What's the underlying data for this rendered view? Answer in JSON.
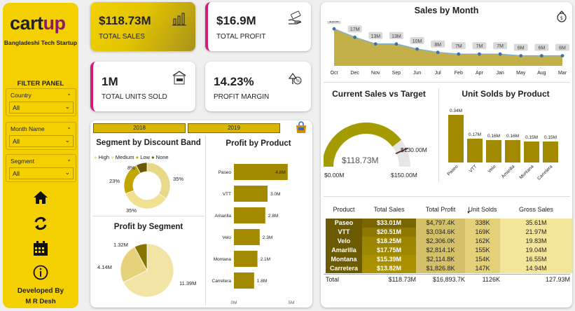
{
  "sidebar": {
    "logo_a": "cart",
    "logo_b": "up",
    "subtitle": "Bangladeshi Tech Startup",
    "filter_title": "FILTER PANEL",
    "filters": [
      {
        "label": "Country",
        "value": "All"
      },
      {
        "label": "Month Name",
        "value": "All"
      },
      {
        "label": "Segment",
        "value": "All"
      }
    ],
    "developed_by": "Developed By",
    "developer": "M R Desh"
  },
  "kpis": [
    {
      "value": "$118.73M",
      "label": "TOTAL SALES",
      "icon": "bar-chart-icon"
    },
    {
      "value": "$16.9M",
      "label": "TOTAL PROFIT",
      "icon": "money-hand-icon"
    },
    {
      "value": "1M",
      "label": "TOTAL UNITS SOLD",
      "icon": "shop-sold-icon"
    },
    {
      "value": "14.23%",
      "label": "PROFIT MARGIN",
      "icon": "margin-up-icon"
    }
  ],
  "year_buttons": [
    "2018",
    "2019"
  ],
  "segment_discount": {
    "title": "Segment by Discount Band",
    "legend": [
      "High",
      "Medium",
      "Low",
      "None"
    ],
    "colors": [
      "#e8d98a",
      "#f0e090",
      "#bfa700",
      "#6b5800"
    ],
    "slice_labels": [
      "35%",
      "35%",
      "23%",
      "8%"
    ]
  },
  "profit_segment": {
    "title": "Profit by Segment",
    "labels": [
      "11.39M",
      "4.14M",
      "1.32M"
    ]
  },
  "profit_product": {
    "title": "Profit by Product",
    "axis": [
      "0M",
      "5M"
    ]
  },
  "sales_month": {
    "title": "Sales by Month"
  },
  "target": {
    "title": "Current Sales vs Target",
    "value": "$118.73M",
    "target": "$130.00M",
    "min": "$0.00M",
    "max": "$150.00M"
  },
  "units_product": {
    "title": "Unit Solds by Product"
  },
  "table": {
    "headers": [
      "Product",
      "Total Sales",
      "Total Profit",
      "Unit Solds",
      "Gross Sales"
    ],
    "rows": [
      [
        "Paseo",
        "$33.01M",
        "$4,797.4K",
        "338K",
        "35.61M"
      ],
      [
        "VTT",
        "$20.51M",
        "$3,034.6K",
        "169K",
        "21.97M"
      ],
      [
        "Velo",
        "$18.25M",
        "$2,306.0K",
        "162K",
        "19.83M"
      ],
      [
        "Amarilla",
        "$17.75M",
        "$2,814.1K",
        "155K",
        "19.04M"
      ],
      [
        "Montana",
        "$15.39M",
        "$2,114.8K",
        "154K",
        "16.55M"
      ],
      [
        "Carretera",
        "$13.82M",
        "$1,826.8K",
        "147K",
        "14.94M"
      ]
    ],
    "total": [
      "Total",
      "$118.73M",
      "$16,893.7K",
      "1126K",
      "127.93M"
    ]
  },
  "chart_data": [
    {
      "type": "area",
      "title": "Sales by Month",
      "categories": [
        "Oct",
        "Dec",
        "Nov",
        "Sep",
        "Jun",
        "Jul",
        "Feb",
        "Apr",
        "Jan",
        "May",
        "Aug",
        "Mar"
      ],
      "values": [
        22,
        17,
        13,
        13,
        10,
        8,
        7,
        7,
        7,
        6,
        6,
        6
      ],
      "labels": [
        "22M",
        "17M",
        "13M",
        "13M",
        "10M",
        "8M",
        "7M",
        "7M",
        "7M",
        "6M",
        "6M",
        "6M"
      ],
      "ylim": [
        0,
        25
      ]
    },
    {
      "type": "bar",
      "title": "Unit Solds by Product",
      "categories": [
        "Paseo",
        "VTT",
        "Velo",
        "Amarilla",
        "Montana",
        "Carretera"
      ],
      "values": [
        0.34,
        0.17,
        0.16,
        0.16,
        0.15,
        0.15
      ],
      "labels": [
        "0.34M",
        "0.17M",
        "0.16M",
        "0.16M",
        "0.15M",
        "0.15M"
      ],
      "ylim": [
        0,
        0.34
      ]
    },
    {
      "type": "bar",
      "title": "Profit by Product",
      "categories": [
        "Paseo",
        "VTT",
        "Amarilla",
        "Velo",
        "Montana",
        "Carretera"
      ],
      "values": [
        4.8,
        3.0,
        2.8,
        2.3,
        2.1,
        1.8
      ],
      "labels": [
        "4.8M",
        "3.0M",
        "2.8M",
        "2.3M",
        "2.1M",
        "1.8M"
      ],
      "xlim": [
        0,
        5
      ]
    },
    {
      "type": "pie",
      "title": "Segment by Discount Band",
      "categories": [
        "High",
        "Medium",
        "Low",
        "None"
      ],
      "values": [
        35,
        35,
        23,
        8
      ]
    },
    {
      "type": "pie",
      "title": "Profit by Segment",
      "values": [
        11.39,
        4.14,
        1.32
      ]
    }
  ]
}
